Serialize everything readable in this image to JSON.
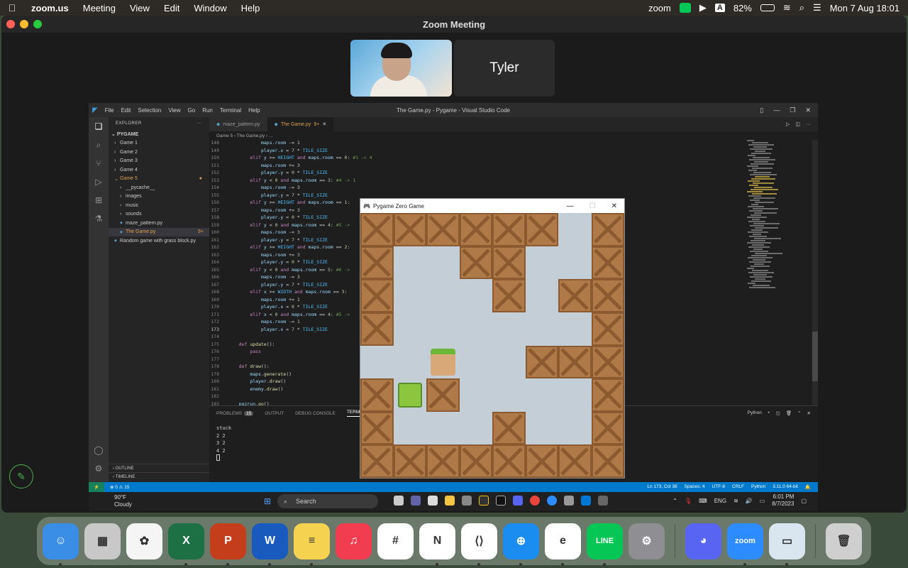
{
  "menubar": {
    "app": "zoom.us",
    "items": [
      "Meeting",
      "View",
      "Edit",
      "Window",
      "Help"
    ],
    "right": {
      "brand": "zoom",
      "input": "A",
      "battery": "82%",
      "datetime": "Mon 7 Aug  18:01"
    }
  },
  "zoom": {
    "title": "Zoom Meeting",
    "participant_name": "Tyler"
  },
  "vscode": {
    "menu": [
      "File",
      "Edit",
      "Selection",
      "View",
      "Go",
      "Run",
      "Terminal",
      "Help"
    ],
    "title": "The Game.py - Pygame - Visual Studio Code",
    "explorer_label": "EXPLORER",
    "project": "PYGAME",
    "tree": [
      {
        "label": "Game 1",
        "indent": 1,
        "chev": "›"
      },
      {
        "label": "Game 2",
        "indent": 1,
        "chev": "›"
      },
      {
        "label": "Game 3",
        "indent": 1,
        "chev": "›"
      },
      {
        "label": "Game 4",
        "indent": 1,
        "chev": "›"
      },
      {
        "label": "Game 5",
        "indent": 1,
        "chev": "⌄"
      },
      {
        "label": "__pycache__",
        "indent": 2,
        "chev": "›"
      },
      {
        "label": "images",
        "indent": 2,
        "chev": "›"
      },
      {
        "label": "music",
        "indent": 2,
        "chev": "›"
      },
      {
        "label": "sounds",
        "indent": 2,
        "chev": "›"
      },
      {
        "label": "maze_pattern.py",
        "indent": 2,
        "chev": ""
      },
      {
        "label": "The Game.py",
        "indent": 2,
        "chev": "",
        "badge": "9+"
      },
      {
        "label": "Random game with grass block.py",
        "indent": 1,
        "chev": ""
      }
    ],
    "outline": "OUTLINE",
    "timeline": "TIMELINE",
    "tabs": [
      {
        "label": "maze_pattern.py"
      },
      {
        "label": "The Game.py",
        "badge": "9+"
      }
    ],
    "breadcrumb": "Game 5  ›  The Game.py  ›  ...",
    "code": [
      [
        "148",
        "            maps.room -= 1"
      ],
      [
        "149",
        "            player.x = 7 * TILE_SIZE"
      ],
      [
        "150",
        "        elif y >= HEIGHT and maps.room == 0: #1 -> 4"
      ],
      [
        "151",
        "            maps.room += 3"
      ],
      [
        "152",
        "            player.y = 0 * TILE_SIZE"
      ],
      [
        "153",
        "        elif y < 0 and maps.room == 3: #4 -> 1"
      ],
      [
        "154",
        "            maps.room -= 3"
      ],
      [
        "155",
        "            player.y = 7 * TILE_SIZE"
      ],
      [
        "156",
        "        elif y >= HEIGHT and maps.room == 1:"
      ],
      [
        "157",
        "            maps.room += 3"
      ],
      [
        "158",
        "            player.y = 0 * TILE_SIZE"
      ],
      [
        "159",
        "        elif y < 0 and maps.room == 4: #5 ->"
      ],
      [
        "160",
        "            maps.room -= 3"
      ],
      [
        "161",
        "            player.y = 7 * TILE_SIZE"
      ],
      [
        "162",
        "        elif y >= HEIGHT and maps.room == 2:"
      ],
      [
        "163",
        "            maps.room += 3"
      ],
      [
        "164",
        "            player.y = 0 * TILE_SIZE"
      ],
      [
        "165",
        "        elif y < 0 and maps.room == 5: #6 ->"
      ],
      [
        "166",
        "            maps.room -= 3"
      ],
      [
        "167",
        "            player.y = 7 * TILE_SIZE"
      ],
      [
        "168",
        "        elif x >= WIDTH and maps.room == 3:"
      ],
      [
        "169",
        "            maps.room += 1"
      ],
      [
        "170",
        "            player.x = 0 * TILE_SIZE"
      ],
      [
        "171",
        "        elif x < 0 and maps.room == 4: #5 ->"
      ],
      [
        "172",
        "            maps.room -= 1"
      ],
      [
        "173",
        "            player.x = 7 * TILE_SIZE"
      ],
      [
        "174",
        ""
      ],
      [
        "175",
        "    def update():"
      ],
      [
        "176",
        "        pass"
      ],
      [
        "177",
        ""
      ],
      [
        "178",
        "    def draw():"
      ],
      [
        "179",
        "        maps.generate()"
      ],
      [
        "180",
        "        player.draw()"
      ],
      [
        "181",
        "        enemy.draw()"
      ],
      [
        "182",
        ""
      ],
      [
        "183",
        "    pgzrun.go()"
      ]
    ],
    "panel_tabs": [
      "PROBLEMS",
      "OUTPUT",
      "DEBUG CONSOLE",
      "TERMINAL"
    ],
    "problems_count": "15",
    "terminal_kind": "Python",
    "terminal_lines": [
      "stuck",
      "2 2",
      "3 2",
      "4 2"
    ],
    "status": {
      "errors": "⊗ 0 ⚠ 15",
      "position": "Ln 173, Col 38",
      "spaces": "Spaces: 4",
      "encoding": "UTF-8",
      "eol": "CRLF",
      "language": "Python",
      "interpreter": "3.11.0 64-bit"
    }
  },
  "game": {
    "title": "Pygame Zero Game",
    "grid": [
      "CCCCCC.C",
      "C..CC..C",
      "C...C.CC",
      "C......C",
      "..P..CCC",
      "CEC....C",
      "C...C..C",
      "CCCCCCCC"
    ]
  },
  "windows_taskbar": {
    "temp": "90°F",
    "weather": "Cloudy",
    "search_placeholder": "Search",
    "lang": "ENG",
    "time": "6:01 PM",
    "date": "8/7/2023"
  },
  "dock": [
    {
      "name": "finder",
      "color": "#3a8ee6",
      "glyph": "☺",
      "running": true
    },
    {
      "name": "launchpad",
      "color": "#c8c8c8",
      "glyph": "▦",
      "running": false
    },
    {
      "name": "photos",
      "color": "#f5f5f5",
      "glyph": "✿",
      "running": false
    },
    {
      "name": "excel",
      "color": "#1d7044",
      "glyph": "X",
      "running": true
    },
    {
      "name": "powerpoint",
      "color": "#c43e1c",
      "glyph": "P",
      "running": true
    },
    {
      "name": "word",
      "color": "#185abd",
      "glyph": "W",
      "running": true
    },
    {
      "name": "notes",
      "color": "#f6d251",
      "glyph": "≡",
      "running": true
    },
    {
      "name": "music",
      "color": "#f23c50",
      "glyph": "♫",
      "running": false
    },
    {
      "name": "slack",
      "color": "#ffffff",
      "glyph": "#",
      "running": false
    },
    {
      "name": "notion",
      "color": "#ffffff",
      "glyph": "N",
      "running": true
    },
    {
      "name": "vscode",
      "color": "#ffffff",
      "glyph": "⟨⟩",
      "running": true
    },
    {
      "name": "safari",
      "color": "#1b8cf0",
      "glyph": "⊕",
      "running": true
    },
    {
      "name": "edge",
      "color": "#ffffff",
      "glyph": "e",
      "running": true
    },
    {
      "name": "line",
      "color": "#06c755",
      "glyph": "LINE",
      "running": true
    },
    {
      "name": "system-settings",
      "color": "#8e8e93",
      "glyph": "⚙",
      "running": false
    },
    {
      "name": "discord",
      "color": "#5865f2",
      "glyph": "◕",
      "running": false
    },
    {
      "name": "zoom",
      "color": "#2d8cff",
      "glyph": "zoom",
      "running": true
    },
    {
      "name": "preview",
      "color": "#d9e6f0",
      "glyph": "▭",
      "running": true
    },
    {
      "name": "trash",
      "color": "#cfcfcf",
      "glyph": "🗑",
      "running": false
    }
  ]
}
